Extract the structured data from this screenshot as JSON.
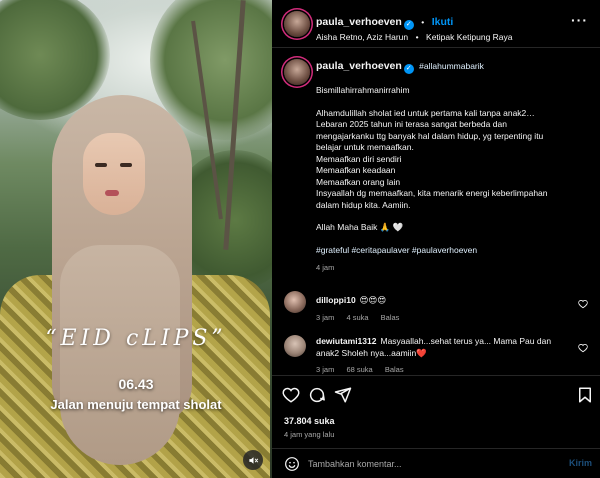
{
  "media": {
    "overlay_title": "“EID cLIPS”",
    "overlay_time": "06.43",
    "overlay_caption": "Jalan menuju tempat sholat",
    "mute_icon": "speaker-muted-icon"
  },
  "header": {
    "username": "paula_verhoeven",
    "follow_label": "Ikuti",
    "separator": "•",
    "collaborators": "Aisha Retno, Aziz Harun",
    "location": "Ketipak Ketipung Raya"
  },
  "caption": {
    "username": "paula_verhoeven",
    "hashtag_inline": "#allahummabarik",
    "lines": [
      "Bismillahirrahmanirrahim",
      "Alhamdulillah sholat ied untuk pertama kali tanpa anak2…",
      "Lebaran 2025 tahun ini terasa sangat berbeda dan",
      "mengajarkanku ttg banyak hal dalam hidup, yg terpenting itu",
      "belajar untuk memaafkan.",
      "Memaafkan diri sendiri",
      "Memaafkan keadaan",
      "Memaafkan orang lain",
      "Insyaallah dg memaafkan, kita menarik energi keberlimpahan",
      "dalam hidup kita. Aamiin.",
      "Allah Maha Baik 🙏 🤍",
      "#grateful #ceritapaulaver #paulaverhoeven"
    ],
    "time": "4 jam"
  },
  "comments": [
    {
      "username": "dilloppi10",
      "text": "😍😍😍",
      "time": "3 jam",
      "likes": "4 suka",
      "reply": "Balas"
    },
    {
      "username": "dewiutami1312",
      "text": "Masyaallah...sehat terus ya... Mama Pau dan anak2 Sholeh nya...aamiin❤️",
      "time": "3 jam",
      "likes": "68 suka",
      "reply": "Balas"
    }
  ],
  "actions": {
    "likes": "37.804 suka",
    "posted": "4 jam yang lalu"
  },
  "compose": {
    "placeholder": "Tambahkan komentar...",
    "send_label": "Kirim"
  },
  "colors": {
    "accent": "#0095f6",
    "background": "#000000",
    "muted_text": "#a8a8a8",
    "divider": "#262626"
  }
}
